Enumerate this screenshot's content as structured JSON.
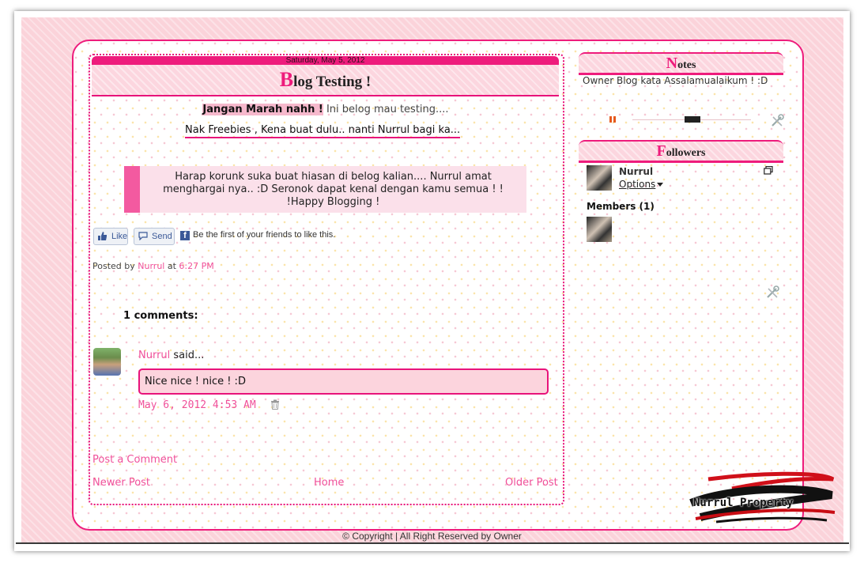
{
  "post": {
    "date": "Saturday, May 5, 2012",
    "title_initial": "B",
    "title_rest": "log Testing !",
    "intro_bold": "Jangan Marah nahh !",
    "intro_text": " Ini belog mau testing....",
    "freebies_text": "Nak Freebies , Kena buat dulu.. nanti Nurrul bagi ka...",
    "quote_line1": "Harap korunk suka buat hiasan di belog kalian.... Nurrul amat",
    "quote_line2": "menghargai nya.. :D Seronok dapat kenal dengan kamu semua ! !",
    "quote_line3": "!Happy Blogging !",
    "posted_by_label": "Posted by",
    "author": "Nurrul",
    "at_label": "at",
    "time": "6:27 PM"
  },
  "facebook": {
    "like_label": "Like",
    "send_label": "Send",
    "f_glyph": "f",
    "social_text": "Be the first of your friends to like this."
  },
  "comments": {
    "heading": "1 comments:",
    "items": [
      {
        "author": "Nurrul",
        "said_label": " said...",
        "text": "Nice nice ! nice ! :D",
        "date": "May 6, 2012 4:53 AM"
      }
    ],
    "post_comment_link": "Post a Comment"
  },
  "nav": {
    "newer": "Newer Post",
    "home": "Home",
    "older": "Older Post"
  },
  "sidebar": {
    "notes": {
      "title_initial": "N",
      "title_rest": "otes",
      "text": "Owner Blog kata Assalamualaikum ! :D"
    },
    "followers": {
      "title_initial": "F",
      "title_rest": "ollowers",
      "name": "Nurrul",
      "options_label": "Options",
      "members_label": "Members (1)"
    }
  },
  "footer": {
    "copyright": "© Copyright  |  All Right Reserved by Owner"
  },
  "watermark": {
    "text": "Nurrul Property"
  },
  "colors": {
    "accent": "#ee1c7c",
    "link": "#f0509a",
    "background": "#fbd3da"
  },
  "icons": [
    "thumbs-up-icon",
    "speech-bubble-icon",
    "facebook-icon",
    "trash-icon",
    "pause-icon",
    "tools-icon",
    "expand-icon",
    "dropdown-caret-icon"
  ]
}
